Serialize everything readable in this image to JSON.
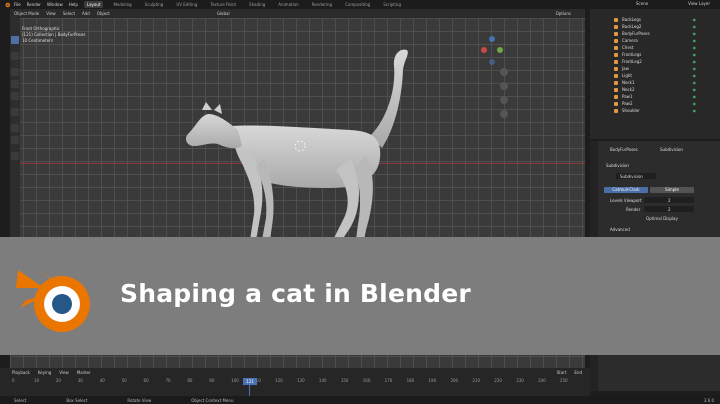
{
  "topbar": {
    "menus": [
      "File",
      "Render",
      "Window",
      "Help"
    ],
    "workspace_tabs": [
      "Layout",
      "Modeling",
      "Sculpting",
      "UV Editing",
      "Texture Paint",
      "Shading",
      "Animation",
      "Rendering",
      "Compositing",
      "Scripting"
    ],
    "active_tab": "Layout",
    "scene_label": "Scene",
    "view_layer_label": "View Layer"
  },
  "viewport": {
    "header_items": [
      "Object Mode",
      "View",
      "Select",
      "Add",
      "Object"
    ],
    "transform_label": "Global",
    "info_lines": [
      "Front Orthographic",
      "(121) Collection | BodyFurPoses",
      "10 Centimeters"
    ],
    "options_label": "Options"
  },
  "outliner": {
    "rows": [
      "BackLegs",
      "BackLeg2",
      "BodyFurPoses",
      "Camera",
      "Chest",
      "FrontLegs",
      "FrontLeg2",
      "Jaw",
      "Light",
      "Neck1",
      "Neck2",
      "Paw1",
      "Paw2",
      "Shoulder"
    ]
  },
  "properties": {
    "context_a": "BodyFurPoses",
    "context_b": "Subdivision",
    "panel_label": "Subdivision",
    "modifier_name": "Subdivision",
    "toggle_a": "Catmull-Clark",
    "toggle_b": "Simple",
    "levels_viewport_label": "Levels Viewport",
    "levels_viewport_value": "2",
    "render_label": "Render",
    "render_value": "2",
    "optimal_display_label": "Optimal Display",
    "advanced_label": "Advanced"
  },
  "timeline": {
    "header_items": [
      "Playback",
      "Keying",
      "View",
      "Marker"
    ],
    "ticks": [
      "0",
      "10",
      "20",
      "30",
      "40",
      "50",
      "60",
      "70",
      "80",
      "90",
      "100",
      "110",
      "120",
      "130",
      "140",
      "150",
      "160",
      "170",
      "180",
      "190",
      "200",
      "210",
      "220",
      "230",
      "240",
      "250"
    ],
    "current_frame": "121",
    "start_label": "Start",
    "end_label": "End"
  },
  "statusbar": {
    "items": [
      "Select",
      "Box Select",
      "Rotate View",
      "Object Context Menu"
    ],
    "version": "3.6.0"
  },
  "banner": {
    "title": "Shaping a cat in Blender"
  },
  "colors": {
    "banner_bg": "#7d7d7d",
    "blender_orange": "#ea7600",
    "blender_blue": "#265787",
    "viewport_bg": "#3a3a3a",
    "accent_blue": "#4a72b7"
  }
}
